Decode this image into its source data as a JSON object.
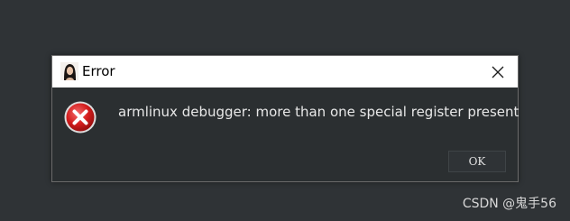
{
  "window": {
    "title": "Error",
    "app_icon": "user-avatar-icon",
    "close_icon": "close-icon"
  },
  "content": {
    "icon": "error-icon",
    "message": "armlinux debugger: more than one special register present"
  },
  "buttons": {
    "ok_label": "OK"
  },
  "watermark": {
    "text": "CSDN @鬼手56"
  },
  "colors": {
    "background": "#2f3336",
    "dialog_body": "#2b2f31",
    "titlebar": "#ffffff",
    "error_red": "#d02020",
    "message_text": "#e8e8e8"
  }
}
